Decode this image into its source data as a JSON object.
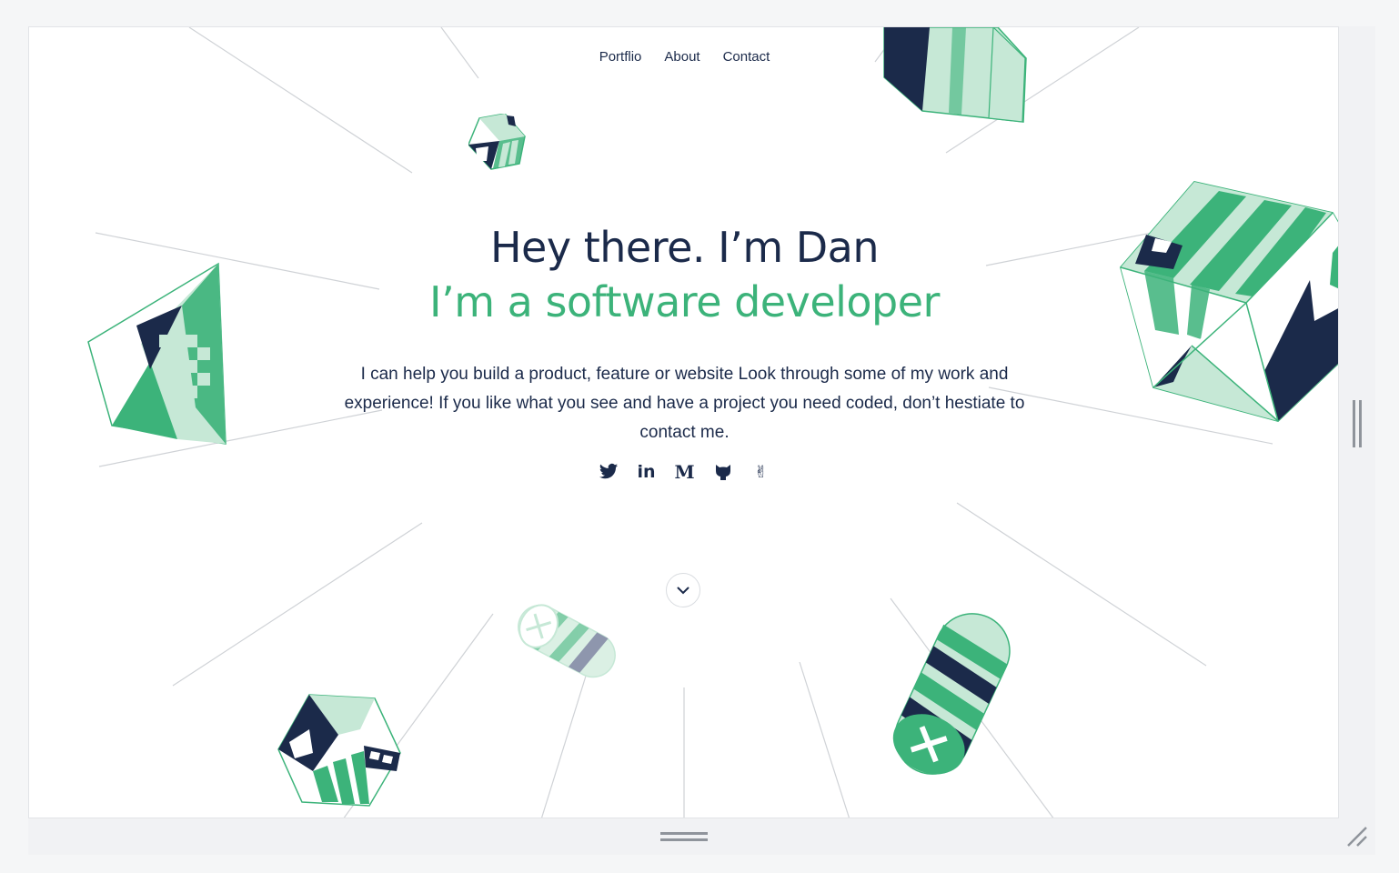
{
  "nav": {
    "items": [
      "Portflio",
      "About",
      "Contact"
    ]
  },
  "hero": {
    "heading": "Hey there. I’m Dan",
    "subheading": "I’m a software developer",
    "description": "I can help you build a product, feature or website Look through some of my work and experience! If you like what you see and have a project you need coded, don’t hestiate to contact me."
  },
  "social": [
    {
      "name": "twitter-icon"
    },
    {
      "name": "linkedin-icon",
      "glyph": "in"
    },
    {
      "name": "medium-icon",
      "glyph": "M"
    },
    {
      "name": "github-icon"
    },
    {
      "name": "angellist-icon",
      "glyph": "✌"
    }
  ],
  "colors": {
    "navy": "#1b2a4a",
    "green": "#3cb37a",
    "mint": "#c6e8d6",
    "gray": "#8e96ad"
  }
}
